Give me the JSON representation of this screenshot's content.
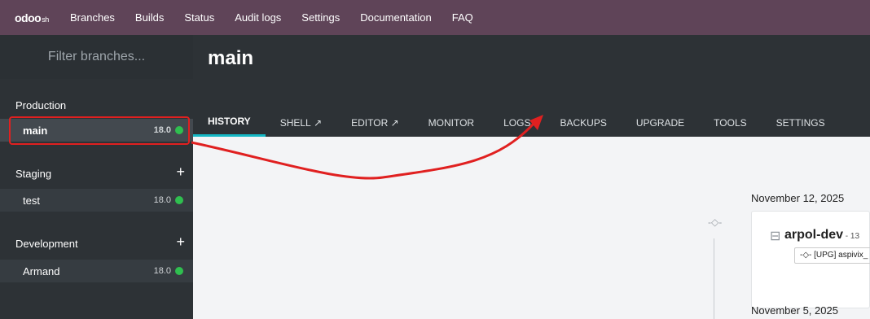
{
  "topnav": {
    "logo_main": "odoo",
    "logo_suffix": "sh",
    "items": [
      "Branches",
      "Builds",
      "Status",
      "Audit logs",
      "Settings",
      "Documentation",
      "FAQ"
    ]
  },
  "sidebar": {
    "filter_placeholder": "Filter branches...",
    "sections": [
      {
        "label": "Production",
        "branches": [
          {
            "name": "main",
            "version": "18.0",
            "status": "running"
          }
        ]
      },
      {
        "label": "Staging",
        "plus": "+",
        "branches": [
          {
            "name": "test",
            "version": "18.0",
            "status": "running"
          }
        ]
      },
      {
        "label": "Development",
        "plus": "+",
        "branches": [
          {
            "name": "Armand",
            "version": "18.0",
            "status": "running"
          }
        ]
      }
    ]
  },
  "header": {
    "branch_title": "main",
    "tabs": [
      "HISTORY",
      "SHELL",
      "EDITOR",
      "MONITOR",
      "LOGS",
      "BACKUPS",
      "UPGRADE",
      "TOOLS",
      "SETTINGS"
    ],
    "active_tab": "HISTORY"
  },
  "history": {
    "dates": [
      "November 12, 2025",
      "November 5, 2025"
    ],
    "card": {
      "title": "arpol-dev",
      "title_suffix": " - 13",
      "commit": "-◇- [UPG] aspivix_"
    }
  },
  "colors": {
    "topnav": "#5f4458",
    "sidebar": "#2d3236",
    "accent_tab": "#14b8c4",
    "status_dot": "#2fbf4f",
    "annotation": "#e02020"
  }
}
